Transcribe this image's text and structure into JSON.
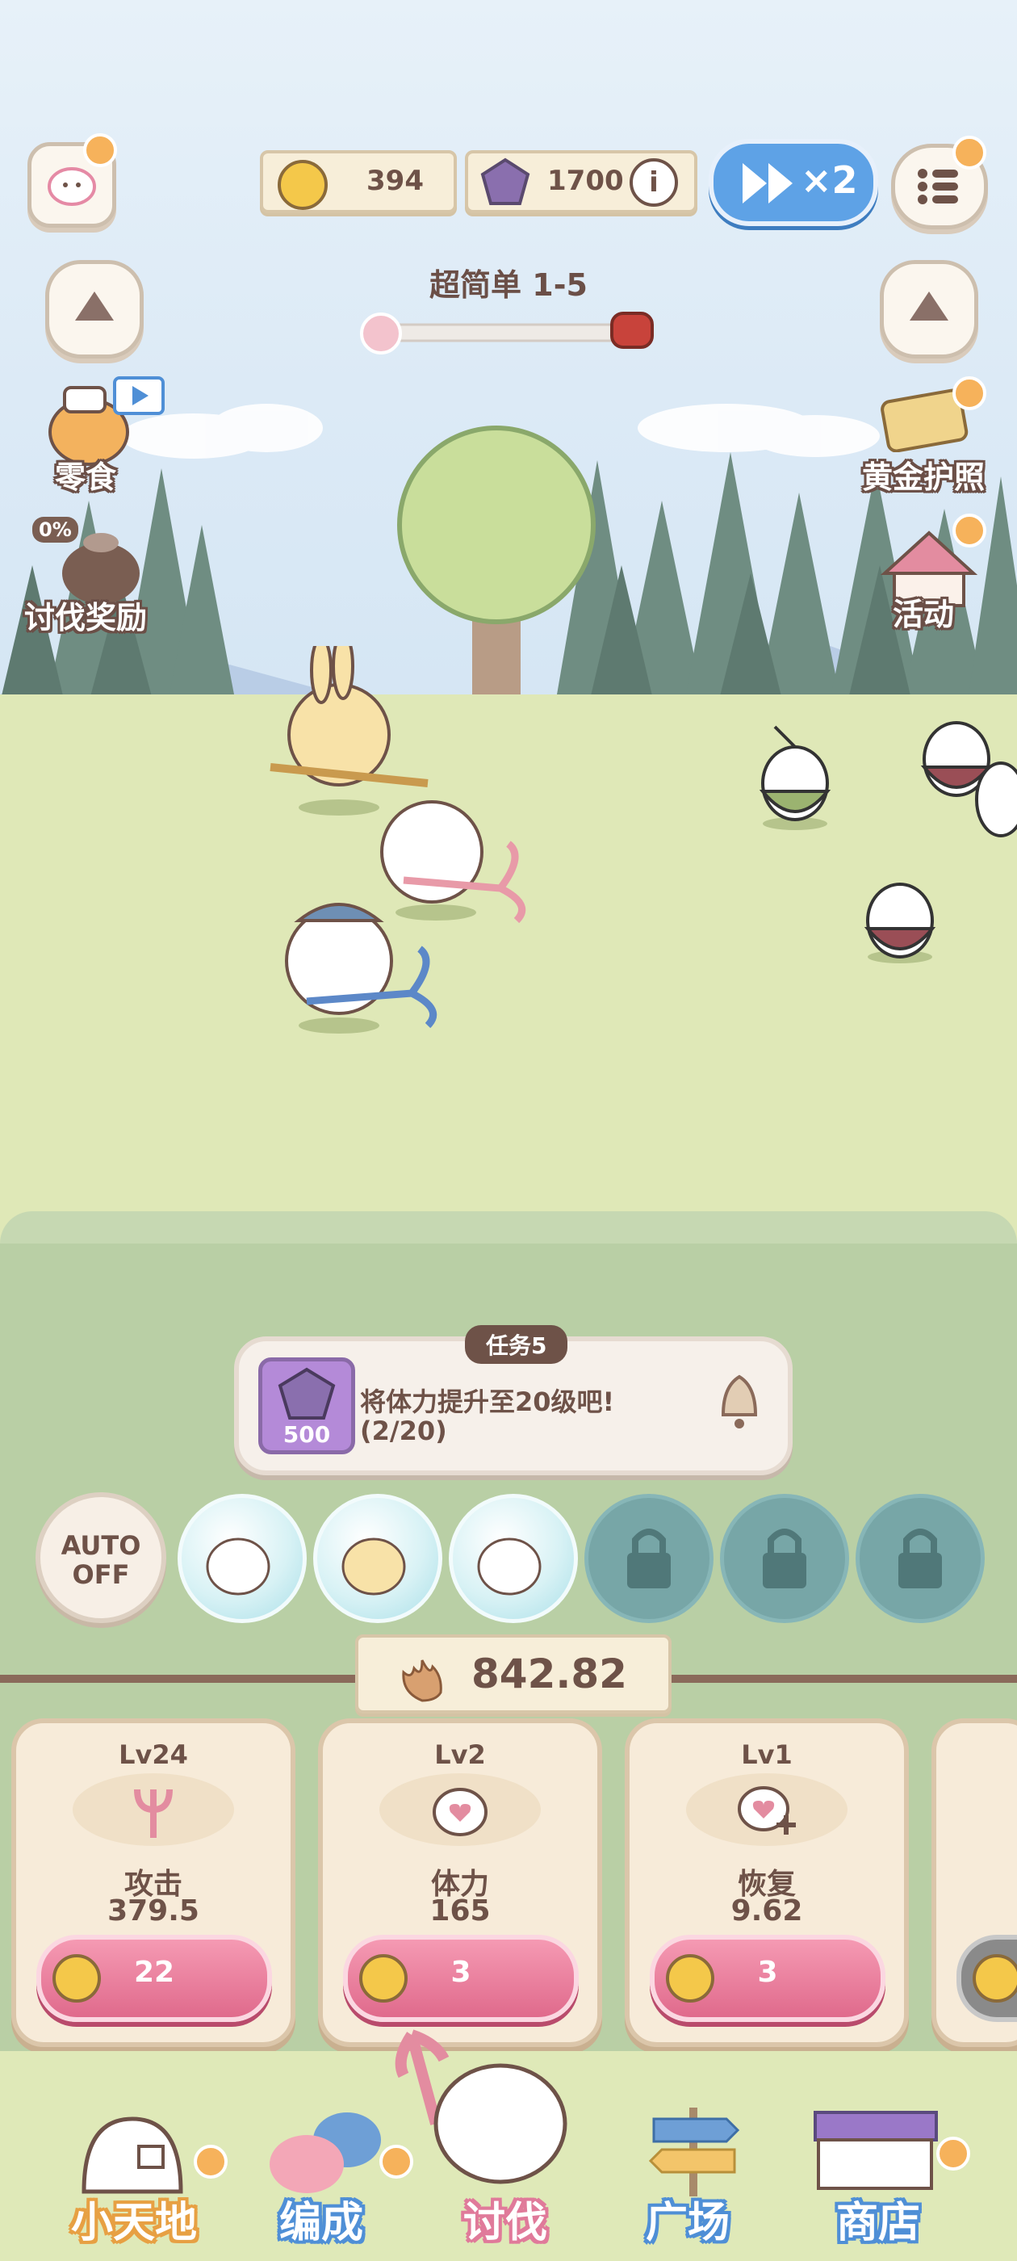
{
  "top": {
    "coins": "394",
    "gems": "1700",
    "speed_label": "×2",
    "stage_title": "超简单 1-5"
  },
  "side_left": {
    "snack_label": "零食",
    "reward_percent": "0%",
    "reward_label": "讨伐奖励"
  },
  "side_right": {
    "passport_label": "黄金护照",
    "event_label": "活动"
  },
  "quest": {
    "tag": "任务5",
    "reward_amount": "500",
    "text": "将体力提升至20级吧!",
    "progress": "(2/20)"
  },
  "auto_button": {
    "line1": "AUTO",
    "line2": "OFF"
  },
  "power": "842.82",
  "upgrades": [
    {
      "level": "Lv24",
      "name": "攻击",
      "value": "379.5",
      "cost": "22"
    },
    {
      "level": "Lv2",
      "name": "体力",
      "value": "165",
      "cost": "3"
    },
    {
      "level": "Lv1",
      "name": "恢复",
      "value": "9.62",
      "cost": "3"
    }
  ],
  "nav": [
    {
      "label": "小天地"
    },
    {
      "label": "编成"
    },
    {
      "label": "讨伐"
    },
    {
      "label": "广场"
    },
    {
      "label": "商店"
    }
  ],
  "colors": {
    "accent_blue": "#5ea2e6",
    "cost_pink": "#e06a8c",
    "notify_orange": "#f6b25b",
    "text_brown": "#6e5248"
  }
}
